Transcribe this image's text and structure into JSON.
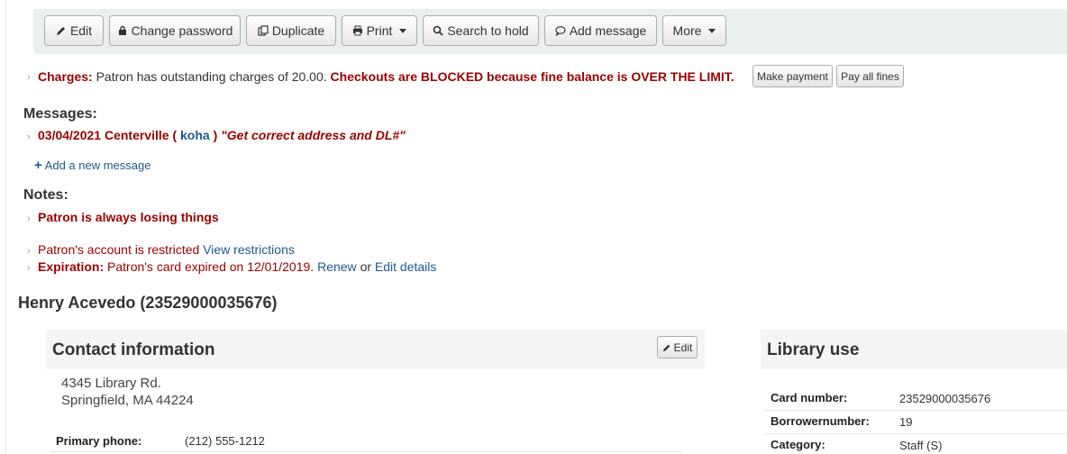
{
  "toolbar": {
    "edit": "Edit",
    "change_password": "Change password",
    "duplicate": "Duplicate",
    "print": "Print",
    "search_to_hold": "Search to hold",
    "add_message": "Add message",
    "more": "More"
  },
  "charges": {
    "label": "Charges:",
    "text": "Patron has outstanding charges of 20.00.",
    "blocked": "Checkouts are BLOCKED because fine balance is OVER THE LIMIT.",
    "make_payment": "Make payment",
    "pay_all_fines": "Pay all fines"
  },
  "messages": {
    "heading": "Messages:",
    "date_branch": "03/04/2021 Centerville (",
    "author": "koha",
    "close": ")",
    "text": "\"Get correct address and DL#\"",
    "add_new": "Add a new message"
  },
  "notes": {
    "heading": "Notes:",
    "text": "Patron is always losing things"
  },
  "restriction": {
    "text": "Patron's account is restricted",
    "link": "View restrictions"
  },
  "expiration": {
    "label": "Expiration:",
    "text": "Patron's card expired on 12/01/2019.",
    "renew": "Renew",
    "or": "or",
    "edit_details": "Edit details"
  },
  "patron": {
    "title": "Henry Acevedo (23529000035676)"
  },
  "contact": {
    "heading": "Contact information",
    "edit": "Edit",
    "address1": "4345 Library Rd.",
    "address2": "Springfield, MA 44224",
    "primary_phone_label": "Primary phone:",
    "primary_phone": "(212) 555-1212"
  },
  "library_use": {
    "heading": "Library use",
    "card_number_label": "Card number:",
    "card_number": "23529000035676",
    "borrowernumber_label": "Borrowernumber:",
    "borrowernumber": "19",
    "category_label": "Category:",
    "category": "Staff (S)"
  },
  "colors": {
    "alert": "#990000",
    "link": "#1d5a8e",
    "toolbar_bg": "#e9f0ee"
  }
}
